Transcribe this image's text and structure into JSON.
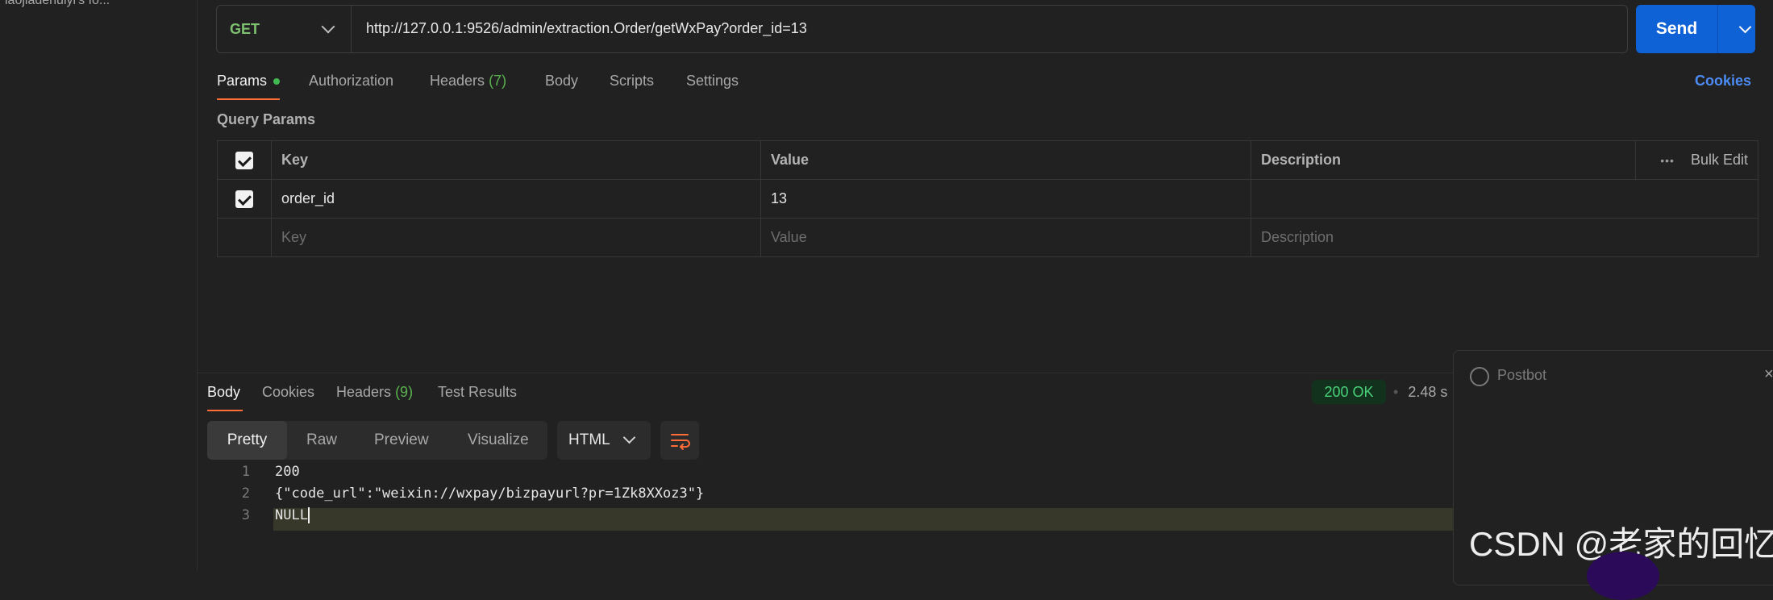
{
  "sidebar": {
    "collection_label": "laojiadehuiyi's fo..."
  },
  "request": {
    "method": "GET",
    "url": "http://127.0.0.1:9526/admin/extraction.Order/getWxPay?order_id=13",
    "send_label": "Send"
  },
  "request_tabs": {
    "params": "Params",
    "authorization": "Authorization",
    "headers": "Headers",
    "headers_count": "(7)",
    "body": "Body",
    "scripts": "Scripts",
    "settings": "Settings",
    "cookies": "Cookies"
  },
  "query_params": {
    "title": "Query Params",
    "col_key": "Key",
    "col_value": "Value",
    "col_description": "Description",
    "bulk_edit": "Bulk Edit",
    "more": "•••",
    "rows": [
      {
        "key": "order_id",
        "value": "13",
        "description": ""
      }
    ],
    "placeholder": {
      "key": "Key",
      "value": "Value",
      "description": "Description"
    }
  },
  "response": {
    "tabs": {
      "body": "Body",
      "cookies": "Cookies",
      "headers": "Headers",
      "headers_count": "(9)",
      "test_results": "Test Results"
    },
    "status": "200 OK",
    "time": "2.48 s",
    "modes": [
      "Pretty",
      "Raw",
      "Preview",
      "Visualize"
    ],
    "format": "HTML",
    "lines": [
      {
        "n": "1",
        "text": "200"
      },
      {
        "n": "2",
        "text": "{\"code_url\":\"weixin://wxpay/bizpayurl?pr=1Zk8XXoz3\"}"
      },
      {
        "n": "3",
        "text": "NULL"
      }
    ]
  },
  "postbot": {
    "title": "Postbot",
    "close": "×"
  },
  "watermark": "CSDN @老家的回忆",
  "colors": {
    "accent_orange": "#ff6c37",
    "send_blue": "#0f62d6",
    "method_green": "#7ec26f",
    "status_green": "#49d17a",
    "cookies_link": "#4c8bf5"
  }
}
